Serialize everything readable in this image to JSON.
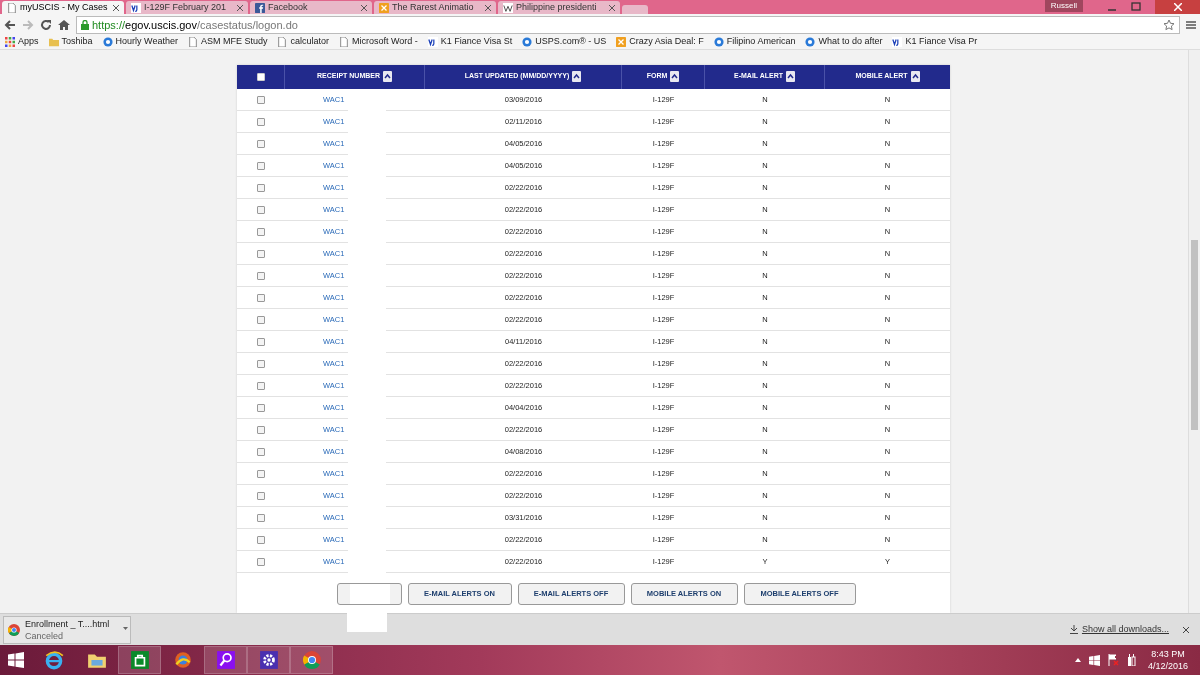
{
  "browser": {
    "tabs": [
      {
        "title": "myUSCIS - My Cases",
        "selected": true
      },
      {
        "title": "I-129F February 201",
        "selected": false
      },
      {
        "title": "Facebook",
        "selected": false
      },
      {
        "title": "The Rarest Animatio",
        "selected": false
      },
      {
        "title": "Philippine presidenti",
        "selected": false
      }
    ],
    "profile": "Russell",
    "address": {
      "scheme": "https://",
      "host": "egov.uscis.gov",
      "path": "/casestatus/logon.do"
    },
    "bookmarks": [
      "Apps",
      "Toshiba",
      "Hourly Weather",
      "ASM MFE Study",
      "calculator",
      "Microsoft Word -",
      "K1 Fiance Visa St",
      "USPS.com® - US",
      "Crazy Asia Deal: F",
      "Filipino American",
      "What to do after",
      "K1 Fiance Visa Pr"
    ]
  },
  "table": {
    "select_all": {
      "checked": false
    },
    "columns": [
      "RECEIPT NUMBER",
      "LAST UPDATED (MM/DD/YYYY)",
      "FORM",
      "E-MAIL ALERT",
      "MOBILE ALERT"
    ],
    "rows": [
      {
        "checked": false,
        "receipt": "WAC1",
        "updated": "03/09/2016",
        "form": "I-129F",
        "email_alert": "N",
        "mobile_alert": "N"
      },
      {
        "checked": false,
        "receipt": "WAC1",
        "updated": "02/11/2016",
        "form": "I-129F",
        "email_alert": "N",
        "mobile_alert": "N"
      },
      {
        "checked": false,
        "receipt": "WAC1",
        "updated": "04/05/2016",
        "form": "I-129F",
        "email_alert": "N",
        "mobile_alert": "N"
      },
      {
        "checked": false,
        "receipt": "WAC1",
        "updated": "04/05/2016",
        "form": "I-129F",
        "email_alert": "N",
        "mobile_alert": "N"
      },
      {
        "checked": false,
        "receipt": "WAC1",
        "updated": "02/22/2016",
        "form": "I-129F",
        "email_alert": "N",
        "mobile_alert": "N"
      },
      {
        "checked": false,
        "receipt": "WAC1",
        "updated": "02/22/2016",
        "form": "I-129F",
        "email_alert": "N",
        "mobile_alert": "N"
      },
      {
        "checked": false,
        "receipt": "WAC1",
        "updated": "02/22/2016",
        "form": "I-129F",
        "email_alert": "N",
        "mobile_alert": "N"
      },
      {
        "checked": false,
        "receipt": "WAC1",
        "updated": "02/22/2016",
        "form": "I-129F",
        "email_alert": "N",
        "mobile_alert": "N"
      },
      {
        "checked": false,
        "receipt": "WAC1",
        "updated": "02/22/2016",
        "form": "I-129F",
        "email_alert": "N",
        "mobile_alert": "N"
      },
      {
        "checked": false,
        "receipt": "WAC1",
        "updated": "02/22/2016",
        "form": "I-129F",
        "email_alert": "N",
        "mobile_alert": "N"
      },
      {
        "checked": false,
        "receipt": "WAC1",
        "updated": "02/22/2016",
        "form": "I-129F",
        "email_alert": "N",
        "mobile_alert": "N"
      },
      {
        "checked": false,
        "receipt": "WAC1",
        "updated": "04/11/2016",
        "form": "I-129F",
        "email_alert": "N",
        "mobile_alert": "N"
      },
      {
        "checked": false,
        "receipt": "WAC1",
        "updated": "02/22/2016",
        "form": "I-129F",
        "email_alert": "N",
        "mobile_alert": "N"
      },
      {
        "checked": false,
        "receipt": "WAC1",
        "updated": "02/22/2016",
        "form": "I-129F",
        "email_alert": "N",
        "mobile_alert": "N"
      },
      {
        "checked": false,
        "receipt": "WAC1",
        "updated": "04/04/2016",
        "form": "I-129F",
        "email_alert": "N",
        "mobile_alert": "N"
      },
      {
        "checked": false,
        "receipt": "WAC1",
        "updated": "02/22/2016",
        "form": "I-129F",
        "email_alert": "N",
        "mobile_alert": "N"
      },
      {
        "checked": false,
        "receipt": "WAC1",
        "updated": "04/08/2016",
        "form": "I-129F",
        "email_alert": "N",
        "mobile_alert": "N"
      },
      {
        "checked": false,
        "receipt": "WAC1",
        "updated": "02/22/2016",
        "form": "I-129F",
        "email_alert": "N",
        "mobile_alert": "N"
      },
      {
        "checked": false,
        "receipt": "WAC1",
        "updated": "02/22/2016",
        "form": "I-129F",
        "email_alert": "N",
        "mobile_alert": "N"
      },
      {
        "checked": false,
        "receipt": "WAC1",
        "updated": "03/31/2016",
        "form": "I-129F",
        "email_alert": "N",
        "mobile_alert": "N"
      },
      {
        "checked": false,
        "receipt": "WAC1",
        "updated": "02/22/2016",
        "form": "I-129F",
        "email_alert": "N",
        "mobile_alert": "N"
      },
      {
        "checked": false,
        "receipt": "WAC1",
        "updated": "02/22/2016",
        "form": "I-129F",
        "email_alert": "Y",
        "mobile_alert": "Y"
      }
    ]
  },
  "buttons": [
    {
      "kind": "covered"
    },
    {
      "kind": "labeled",
      "label": "E-MAIL ALERTS ON"
    },
    {
      "kind": "labeled",
      "label": "E-MAIL ALERTS OFF"
    },
    {
      "kind": "labeled",
      "label": "MOBILE ALERTS ON"
    },
    {
      "kind": "labeled",
      "label": "MOBILE ALERTS OFF"
    }
  ],
  "download_shelf": {
    "item": {
      "name": "Enrollment _ T....html",
      "status": "Canceled"
    },
    "show_all": "Show all downloads..."
  },
  "taskbar": {
    "time": "8:43 PM",
    "date": "4/12/2016"
  }
}
